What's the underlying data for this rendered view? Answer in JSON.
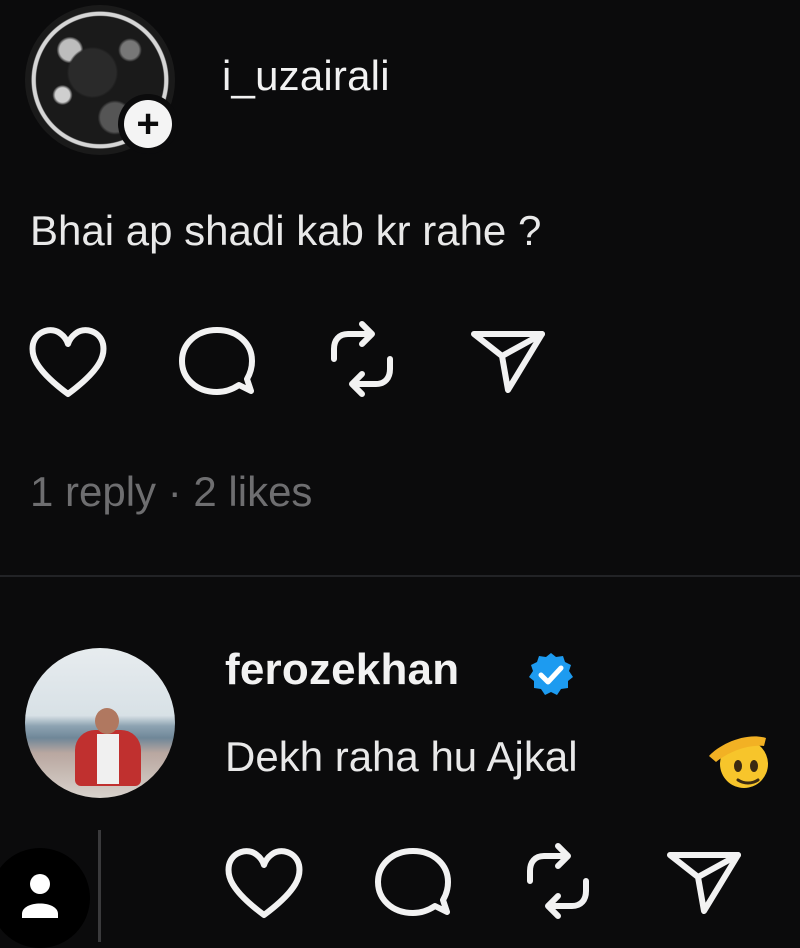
{
  "post1": {
    "username": "i_uzairali",
    "comment": "Bhai ap shadi kab kr rahe ?",
    "meta": "1 reply · 2 likes",
    "actions": [
      "heart-icon",
      "comment-icon",
      "repost-icon",
      "share-icon"
    ],
    "avatar_badge": "+"
  },
  "post2": {
    "username": "ferozekhan",
    "verified": true,
    "comment": "Dekh raha hu Ajkal",
    "emoji": "saluting-face",
    "actions": [
      "heart-icon",
      "comment-icon",
      "repost-icon",
      "share-icon"
    ]
  },
  "colors": {
    "background": "#0b0b0c",
    "text": "#f2f2f2",
    "meta": "#6e6e70",
    "verified": "#1d9bf0"
  }
}
